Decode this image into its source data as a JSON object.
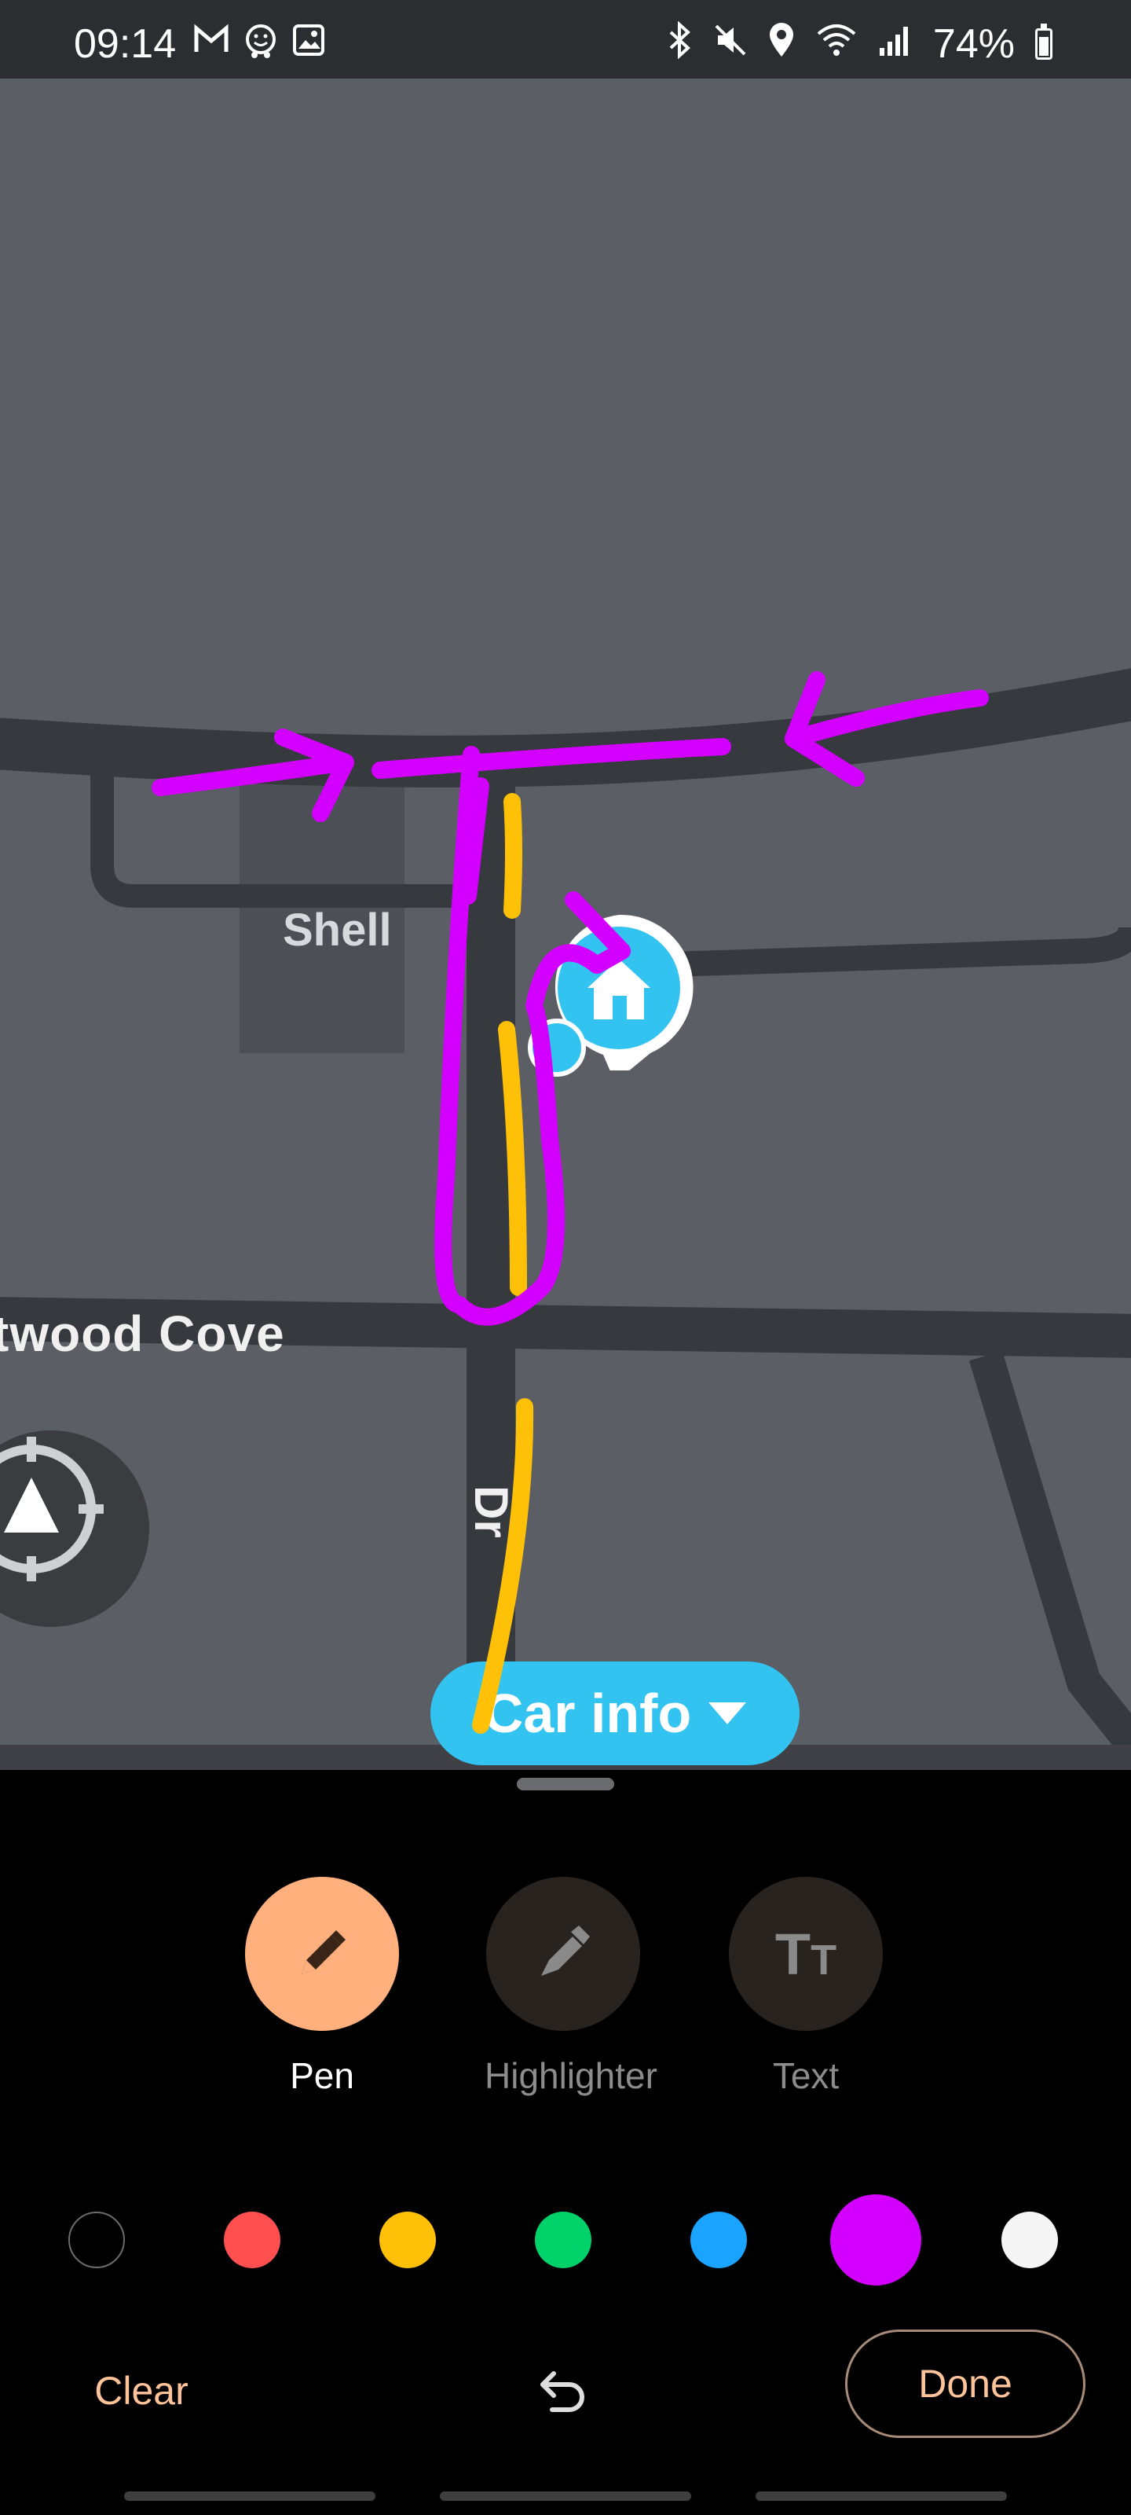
{
  "status_bar": {
    "time": "09:14",
    "left_icons": [
      "gmail-icon",
      "waze-icon",
      "gallery-icon"
    ],
    "right_icons": [
      "bluetooth-icon",
      "mute-icon",
      "location-icon",
      "wifi-icon",
      "signal-icon"
    ],
    "battery_text": "74%",
    "battery_level": 0.74
  },
  "map": {
    "labels": {
      "shell": "Shell",
      "cove": "twood Cove",
      "street": "Dr"
    },
    "car_info_label": "Car info",
    "colors": {
      "background": "#5b5e64",
      "roads": "#36393e",
      "accent": "#33c3f0"
    }
  },
  "editor": {
    "tools": [
      {
        "label": "Pen",
        "active": true
      },
      {
        "label": "Highlighter",
        "active": false
      },
      {
        "label": "Text",
        "active": false
      }
    ],
    "colors": [
      "#000000",
      "#ff4f4f",
      "#ffc107",
      "#00d26a",
      "#1aa3ff",
      "#d400ff",
      "#f5f5f5"
    ],
    "selected_color": "#d400ff",
    "clear_label": "Clear",
    "done_label": "Done"
  }
}
